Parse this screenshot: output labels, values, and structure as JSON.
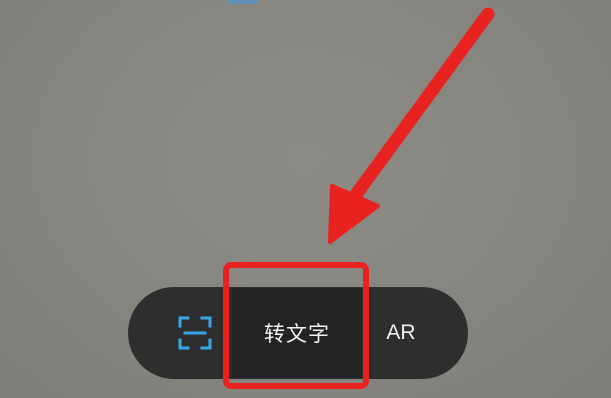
{
  "mode_bar": {
    "tabs": [
      {
        "id": "scan",
        "icon": "scan-icon",
        "label": ""
      },
      {
        "id": "to-text",
        "label": "转文字",
        "selected": true
      },
      {
        "id": "ar",
        "label": "AR"
      }
    ]
  },
  "colors": {
    "background": "#868580",
    "bar": "#2e2e2e",
    "selected_tab": "#232323",
    "scan_icon": "#3aa6e8",
    "annotation_red": "#e8231f"
  },
  "annotation": {
    "type": "arrow-and-box",
    "target": "to-text"
  }
}
